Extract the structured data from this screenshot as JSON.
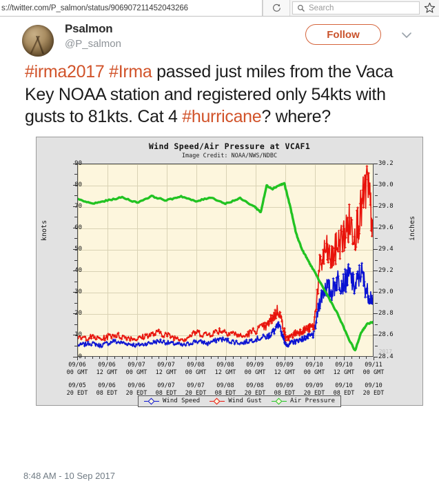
{
  "browser": {
    "url": "s://twitter.com/P_salmon/status/906907211452043266",
    "reload_icon": "reload-icon",
    "search_icon": "search-icon",
    "search_placeholder": "Search",
    "bookmark_icon": "star-icon"
  },
  "tweet": {
    "display_name": "Psalmon",
    "handle": "@P_salmon",
    "follow_label": "Follow",
    "caret_icon": "chevron-down-icon",
    "timestamp": "8:48 AM - 10 Sep 2017",
    "text_segments": [
      {
        "t": "#irma2017",
        "hashtag": true
      },
      {
        "t": " ",
        "hashtag": false
      },
      {
        "t": "#Irma",
        "hashtag": true
      },
      {
        "t": " passed just miles from the Vaca Key NOAA station and registered only 54kts with gusts to 81kts.  Cat 4 ",
        "hashtag": false
      },
      {
        "t": "#hurricane",
        "hashtag": true
      },
      {
        "t": "? where?",
        "hashtag": false
      }
    ],
    "accent_color": "#d1532a"
  },
  "chart_data": {
    "type": "line",
    "title": "Wind Speed/Air Pressure at VCAF1",
    "subtitle": "Image Credit: NOAA/NWS/NDBC",
    "year_label": "2017",
    "xlabel": "",
    "ylabel": "knots",
    "ylabel_right": "inches",
    "ylim": [
      0,
      90
    ],
    "yticks": [
      0,
      10,
      20,
      30,
      40,
      50,
      60,
      70,
      80,
      90
    ],
    "ylim_right": [
      28.4,
      30.2
    ],
    "yticks_right": [
      "28.4",
      "28.6",
      "28.8",
      "29.0",
      "29.2",
      "29.4",
      "29.6",
      "29.8",
      "30.0",
      "30.2"
    ],
    "grid": true,
    "legend_position": "bottom",
    "background_color": "#fdf6dd",
    "x_tick_labels_gmt": [
      "09/06\n00 GMT",
      "09/06\n12 GMT",
      "09/07\n00 GMT",
      "09/07\n12 GMT",
      "09/08\n00 GMT",
      "09/08\n12 GMT",
      "09/09\n00 GMT",
      "09/09\n12 GMT",
      "09/10\n00 GMT",
      "09/10\n12 GMT",
      "09/11\n00 GMT"
    ],
    "x_tick_labels_edt": [
      "09/05\n20 EDT",
      "09/06\n08 EDT",
      "09/06\n20 EDT",
      "09/07\n08 EDT",
      "09/07\n20 EDT",
      "09/08\n08 EDT",
      "09/08\n20 EDT",
      "09/09\n08 EDT",
      "09/09\n20 EDT",
      "09/10\n08 EDT",
      "09/10\n20 EDT"
    ],
    "series": [
      {
        "name": "Wind Speed",
        "color": "#0a12d2",
        "axis": "left",
        "unit": "knots",
        "x": [
          0,
          0.04,
          0.08,
          0.12,
          0.16,
          0.2,
          0.24,
          0.28,
          0.32,
          0.36,
          0.4,
          0.44,
          0.48,
          0.52,
          0.56,
          0.6,
          0.64,
          0.66,
          0.68,
          0.7,
          0.705,
          0.72,
          0.74,
          0.76,
          0.78,
          0.8,
          0.82,
          0.84,
          0.86,
          0.88,
          0.9,
          0.92,
          0.94,
          0.96,
          0.98,
          1.0
        ],
        "values": [
          5,
          6,
          5,
          7,
          6,
          5,
          6,
          7,
          6,
          5,
          7,
          6,
          8,
          7,
          6,
          8,
          9,
          11,
          14,
          8,
          5,
          6,
          7,
          8,
          9,
          10,
          26,
          33,
          30,
          36,
          34,
          38,
          32,
          40,
          30,
          27
        ]
      },
      {
        "name": "Wind Gust",
        "color": "#e8130b",
        "axis": "left",
        "unit": "knots",
        "x": [
          0,
          0.04,
          0.08,
          0.12,
          0.16,
          0.2,
          0.24,
          0.28,
          0.32,
          0.36,
          0.4,
          0.44,
          0.48,
          0.52,
          0.56,
          0.6,
          0.64,
          0.66,
          0.68,
          0.7,
          0.705,
          0.72,
          0.74,
          0.76,
          0.78,
          0.8,
          0.82,
          0.84,
          0.86,
          0.88,
          0.9,
          0.92,
          0.94,
          0.96,
          0.98,
          1.0
        ],
        "values": [
          8,
          9,
          8,
          10,
          9,
          8,
          10,
          11,
          9,
          8,
          11,
          10,
          12,
          11,
          9,
          12,
          14,
          18,
          22,
          12,
          8,
          9,
          11,
          12,
          13,
          14,
          41,
          50,
          45,
          52,
          56,
          62,
          58,
          68,
          81,
          62
        ]
      },
      {
        "name": "Air Pressure",
        "color": "#22c322",
        "axis": "right",
        "unit": "inches",
        "x": [
          0,
          0.05,
          0.1,
          0.15,
          0.2,
          0.25,
          0.3,
          0.35,
          0.4,
          0.45,
          0.5,
          0.55,
          0.6,
          0.62,
          0.64,
          0.66,
          0.68,
          0.7,
          0.72,
          0.74,
          0.76,
          0.78,
          0.8,
          0.84,
          0.88,
          0.92,
          0.94,
          0.96,
          0.98,
          1.0
        ],
        "values": [
          29.87,
          29.83,
          29.86,
          29.89,
          29.84,
          29.9,
          29.86,
          29.9,
          29.85,
          29.89,
          29.83,
          29.88,
          29.8,
          29.75,
          30.0,
          29.97,
          30.0,
          30.02,
          29.8,
          29.55,
          29.4,
          29.3,
          29.2,
          29.0,
          28.8,
          28.55,
          28.45,
          28.62,
          28.7,
          28.72
        ]
      }
    ],
    "legend": [
      {
        "label": "Wind Speed",
        "color": "#0a12d2"
      },
      {
        "label": "Wind Gust",
        "color": "#e8130b"
      },
      {
        "label": "Air Pressure",
        "color": "#22c322"
      }
    ]
  }
}
